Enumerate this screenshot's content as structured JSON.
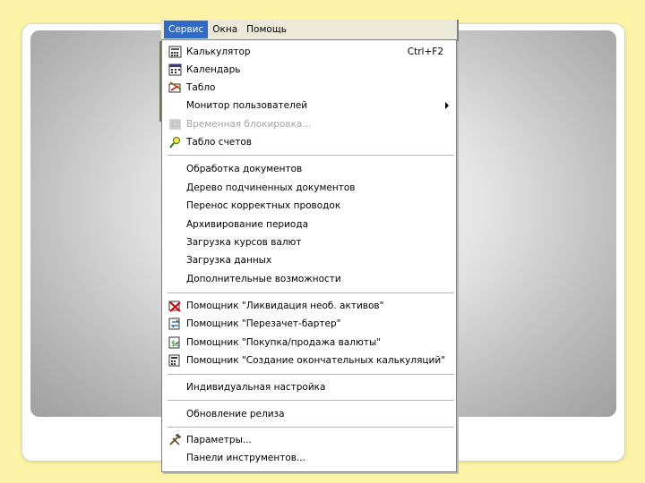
{
  "menubar": {
    "items": [
      "Сервис",
      "Окна",
      "Помощь"
    ]
  },
  "menu": {
    "items": [
      {
        "label": "Калькулятор",
        "shortcut": "Ctrl+F2",
        "icon": "calculator-icon"
      },
      {
        "label": "Календарь",
        "icon": "calendar-icon"
      },
      {
        "label": "Табло",
        "icon": "board-icon"
      },
      {
        "label": "Монитор пользователей",
        "submenu": true
      },
      {
        "label": "Временная блокировка...",
        "disabled": true,
        "icon": "lock-icon"
      },
      {
        "label": "Табло счетов",
        "icon": "accounts-board-icon"
      },
      {
        "label": "Обработка документов"
      },
      {
        "label": "Дерево подчиненных документов"
      },
      {
        "label": "Перенос корректных проводок"
      },
      {
        "label": "Архивирование периода"
      },
      {
        "label": "Загрузка курсов валют"
      },
      {
        "label": "Загрузка данных"
      },
      {
        "label": "Дополнительные возможности"
      },
      {
        "label": "Помощник \"Ликвидация необ. активов\"",
        "icon": "liquidation-wizard-icon"
      },
      {
        "label": "Помощник \"Перезачет-бартер\"",
        "icon": "barter-wizard-icon"
      },
      {
        "label": "Помощник \"Покупка/продажа валюты\"",
        "icon": "currency-wizard-icon"
      },
      {
        "label": "Помощник \"Создание окончательных калькуляций\"",
        "icon": "calculation-wizard-icon"
      },
      {
        "label": "Индивидуальная настройка"
      },
      {
        "label": "Обновление релиза"
      },
      {
        "label": "Параметры...",
        "icon": "tools-icon"
      },
      {
        "label": "Панели инструментов..."
      }
    ]
  },
  "colors": {
    "background": "#fdf3a6",
    "menu_highlight": "#316ac5",
    "disabled_text": "#a5a5a5"
  }
}
